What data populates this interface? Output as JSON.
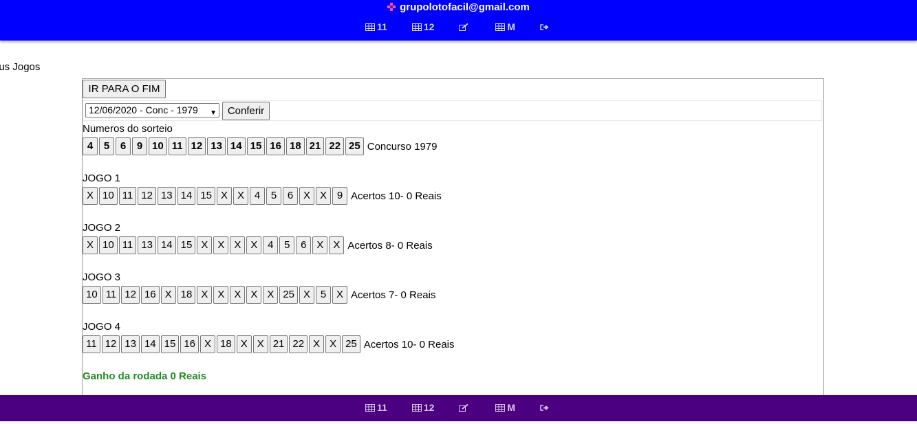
{
  "header": {
    "email": "grupolotofacil@gmail.com",
    "nav": [
      {
        "label": "11",
        "icon": "table-icon"
      },
      {
        "label": "12",
        "icon": "table-icon"
      },
      {
        "label": "",
        "icon": "edit-icon"
      },
      {
        "label": "M",
        "icon": "table-icon"
      },
      {
        "label": "",
        "icon": "sign-out-icon"
      }
    ],
    "color": "#0000ff"
  },
  "footer": {
    "nav": [
      {
        "label": "11",
        "icon": "table-icon"
      },
      {
        "label": "12",
        "icon": "table-icon"
      },
      {
        "label": "",
        "icon": "edit-icon"
      },
      {
        "label": "M",
        "icon": "table-icon"
      },
      {
        "label": "",
        "icon": "sign-out-icon"
      }
    ],
    "color": "#4b0082"
  },
  "page_label": "eus Jogos",
  "controls": {
    "goto_end_label": "IR PARA O FIM",
    "select_value": "12/06/2020 - Conc - 1979",
    "check_label": "Conferir"
  },
  "draw": {
    "label": "Numeros do sorteio",
    "numbers": [
      "4",
      "5",
      "6",
      "9",
      "10",
      "11",
      "12",
      "13",
      "14",
      "15",
      "16",
      "18",
      "21",
      "22",
      "25"
    ],
    "contest": "Concurso 1979"
  },
  "games": [
    {
      "label": "JOGO 1",
      "numbers": [
        "X",
        "10",
        "11",
        "12",
        "13",
        "14",
        "15",
        "X",
        "X",
        "4",
        "5",
        "6",
        "X",
        "X",
        "9"
      ],
      "result": "Acertos 10- 0 Reais"
    },
    {
      "label": "JOGO 2",
      "numbers": [
        "X",
        "10",
        "11",
        "13",
        "14",
        "15",
        "X",
        "X",
        "X",
        "X",
        "4",
        "5",
        "6",
        "X",
        "X"
      ],
      "result": "Acertos 8- 0 Reais"
    },
    {
      "label": "JOGO 3",
      "numbers": [
        "10",
        "11",
        "12",
        "16",
        "X",
        "18",
        "X",
        "X",
        "X",
        "X",
        "X",
        "25",
        "X",
        "5",
        "X"
      ],
      "result": "Acertos 7- 0 Reais"
    },
    {
      "label": "JOGO 4",
      "numbers": [
        "11",
        "12",
        "13",
        "14",
        "15",
        "16",
        "X",
        "18",
        "X",
        "X",
        "21",
        "22",
        "X",
        "X",
        "25"
      ],
      "result": "Acertos 10- 0 Reais"
    }
  ],
  "gain": "Ganho da rodada 0 Reais",
  "gain_color": "#228b22"
}
